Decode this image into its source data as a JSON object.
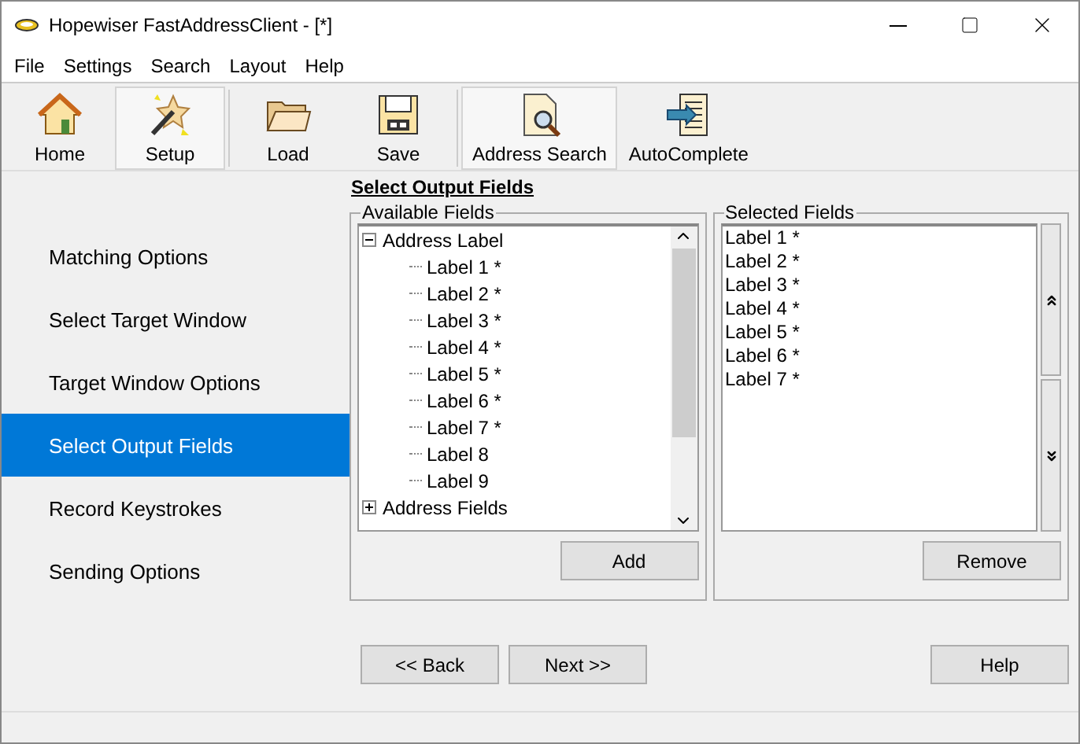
{
  "window": {
    "title": "Hopewiser FastAddressClient - [*]"
  },
  "menu": [
    "File",
    "Settings",
    "Search",
    "Layout",
    "Help"
  ],
  "toolbar": [
    {
      "label": "Home",
      "kind": "home",
      "selected": false
    },
    {
      "label": "Setup",
      "kind": "setup",
      "selected": true
    },
    {
      "label": "Load",
      "kind": "load",
      "selected": false
    },
    {
      "label": "Save",
      "kind": "save",
      "selected": false
    },
    {
      "label": "Address Search",
      "kind": "search",
      "selected": true
    },
    {
      "label": "AutoComplete",
      "kind": "autocomplete",
      "selected": false
    }
  ],
  "sidebar": {
    "items": [
      {
        "label": "Matching Options",
        "selected": false
      },
      {
        "label": "Select Target Window",
        "selected": false
      },
      {
        "label": "Target Window Options",
        "selected": false
      },
      {
        "label": "Select Output Fields",
        "selected": true
      },
      {
        "label": "Record Keystrokes",
        "selected": false
      },
      {
        "label": "Sending Options",
        "selected": false
      }
    ]
  },
  "heading": "Select Output Fields",
  "available": {
    "title": "Available Fields",
    "tree": [
      {
        "label": "Address Label",
        "expanded": true,
        "children": [
          {
            "label": "Label 1 *"
          },
          {
            "label": "Label 2 *"
          },
          {
            "label": "Label 3 *"
          },
          {
            "label": "Label 4 *"
          },
          {
            "label": "Label 5 *"
          },
          {
            "label": "Label 6 *"
          },
          {
            "label": "Label 7 *"
          },
          {
            "label": "Label 8"
          },
          {
            "label": "Label 9"
          }
        ]
      },
      {
        "label": "Address Fields",
        "expanded": false
      }
    ],
    "button": "Add"
  },
  "selected": {
    "title": "Selected Fields",
    "items": [
      "Label 1 *",
      "Label 2 *",
      "Label 3 *",
      "Label 4 *",
      "Label 5 *",
      "Label 6 *",
      "Label 7 *"
    ],
    "button": "Remove"
  },
  "footer": {
    "back": "<< Back",
    "next": "Next >>",
    "help": "Help"
  }
}
